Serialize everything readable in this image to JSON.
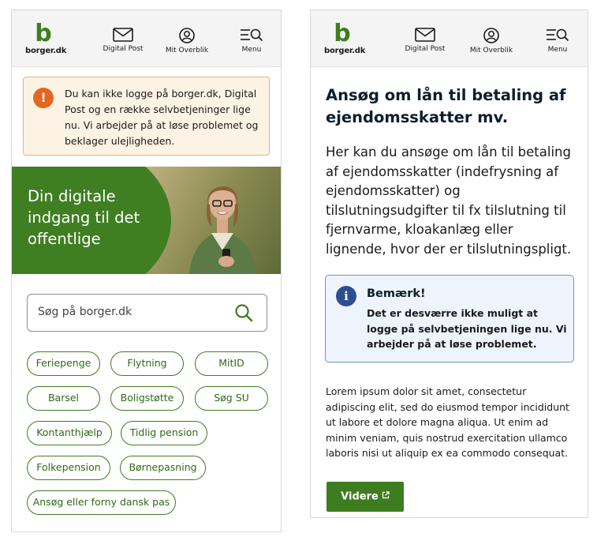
{
  "header": {
    "brand_letter": "b",
    "brand_name": "borger.dk",
    "nav": [
      {
        "label": "Digital Post",
        "icon": "mail-icon"
      },
      {
        "label": "Mit Overblik",
        "icon": "user-circle-icon"
      },
      {
        "label": "Menu",
        "icon": "menu-search-icon"
      }
    ]
  },
  "left": {
    "alert": {
      "icon": "!",
      "text": "Du kan ikke logge på borger.dk, Digital Post og en række selvbetjeninger lige nu. Vi arbejder på at løse problemet og beklager ulejligheden."
    },
    "hero_title": "Din digitale indgang til det offentlige",
    "search_placeholder": "Søg på borger.dk",
    "chips": [
      "Feriepenge",
      "Flytning",
      "MitID",
      "Barsel",
      "Boligstøtte",
      "Søg SU",
      "Kontanthjælp",
      "Tidlig pension",
      "Folkepension",
      "Børnepasning",
      "Ansøg eller forny dansk pas"
    ]
  },
  "right": {
    "title": "Ansøg om lån til betaling af ejendomsskatter mv.",
    "lead": "Her kan du ansøge om lån til betaling af ejendomsskatter (indefrysning af ejendomsskatter) og tilslutningsudgifter til fx tilslutning til fjernvarme, kloakanlæg eller lignende, hvor der er tilslutningspligt.",
    "note": {
      "icon": "i",
      "title": "Bemærk!",
      "body": "Det er desværre ikke muligt at logge på selvbetjeningen lige nu. Vi arbejder på at løse problemet."
    },
    "lorem": "Lorem ipsum dolor sit amet, consectetur adipiscing elit, sed do eiusmod tempor incididunt ut labore et dolore magna aliqua. Ut enim ad minim veniam, quis nostrud exercitation ullamco laboris nisi ut aliquip ex ea commodo consequat.",
    "button_label": "Videre"
  },
  "colors": {
    "brand_green": "#3e7d1f",
    "warning_orange": "#e4661f",
    "info_blue": "#2b4e93"
  }
}
